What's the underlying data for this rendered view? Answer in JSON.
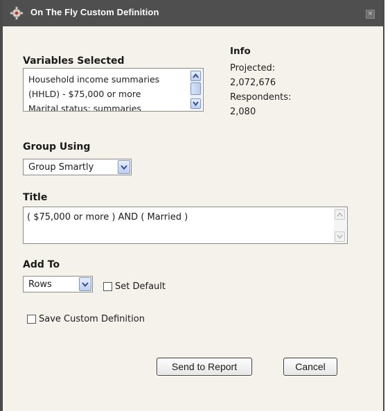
{
  "dialog": {
    "title": "On The Fly Custom Definition",
    "close_symbol": "×"
  },
  "variables": {
    "label": "Variables Selected",
    "items": [
      "Household income summaries",
      "(HHLD) - $75,000 or more",
      "Marital status: summaries"
    ]
  },
  "info": {
    "label": "Info",
    "projected_label": "Projected:",
    "projected_value": "2,072,676",
    "respondents_label": "Respondents:",
    "respondents_value": "2,080"
  },
  "group_using": {
    "label": "Group Using",
    "selected": "Group Smartly"
  },
  "title_field": {
    "label": "Title",
    "value": "( $75,000 or more ) AND ( Married )"
  },
  "add_to": {
    "label": "Add To",
    "selected": "Rows",
    "set_default_label": "Set Default"
  },
  "save_custom_label": "Save Custom Definition",
  "buttons": {
    "send": "Send to Report",
    "cancel": "Cancel"
  }
}
